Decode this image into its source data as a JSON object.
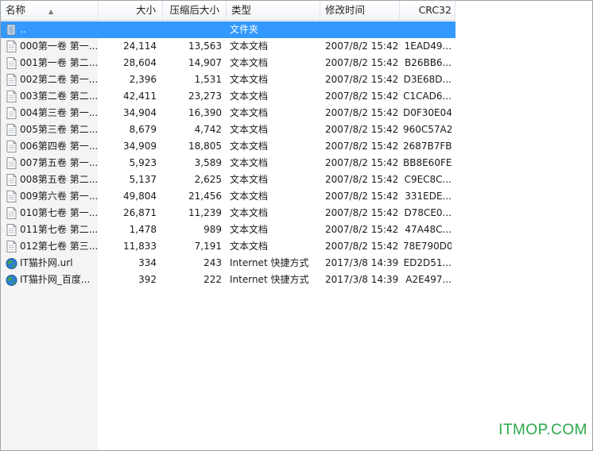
{
  "columns": {
    "name": "名称",
    "size": "大小",
    "packed": "压缩后大小",
    "type": "类型",
    "modified": "修改时间",
    "crc": "CRC32"
  },
  "parent_row": {
    "name": "..",
    "type": "文件夹"
  },
  "files": [
    {
      "name": "000第一卷 第一...",
      "size": "24,114",
      "packed": "13,563",
      "type": "文本文档",
      "modified": "2007/8/2 15:42",
      "crc": "1EAD49..."
    },
    {
      "name": "001第一卷 第二...",
      "size": "28,604",
      "packed": "14,907",
      "type": "文本文档",
      "modified": "2007/8/2 15:42",
      "crc": "B26BB6..."
    },
    {
      "name": "002第二卷 第一...",
      "size": "2,396",
      "packed": "1,531",
      "type": "文本文档",
      "modified": "2007/8/2 15:42",
      "crc": "D3E68D..."
    },
    {
      "name": "003第二卷 第二...",
      "size": "42,411",
      "packed": "23,273",
      "type": "文本文档",
      "modified": "2007/8/2 15:42",
      "crc": "C1CAD6..."
    },
    {
      "name": "004第三卷 第一...",
      "size": "34,904",
      "packed": "16,390",
      "type": "文本文档",
      "modified": "2007/8/2 15:42",
      "crc": "D0F30E04"
    },
    {
      "name": "005第三卷 第二...",
      "size": "8,679",
      "packed": "4,742",
      "type": "文本文档",
      "modified": "2007/8/2 15:42",
      "crc": "960C57A2"
    },
    {
      "name": "006第四卷 第一...",
      "size": "34,909",
      "packed": "18,805",
      "type": "文本文档",
      "modified": "2007/8/2 15:42",
      "crc": "2687B7FB"
    },
    {
      "name": "007第五卷 第一...",
      "size": "5,923",
      "packed": "3,589",
      "type": "文本文档",
      "modified": "2007/8/2 15:42",
      "crc": "BB8E60FE"
    },
    {
      "name": "008第五卷 第二...",
      "size": "5,137",
      "packed": "2,625",
      "type": "文本文档",
      "modified": "2007/8/2 15:42",
      "crc": "C9EC8C..."
    },
    {
      "name": "009第六卷 第一...",
      "size": "49,804",
      "packed": "21,456",
      "type": "文本文档",
      "modified": "2007/8/2 15:42",
      "crc": "331EDE..."
    },
    {
      "name": "010第七卷 第一...",
      "size": "26,871",
      "packed": "11,239",
      "type": "文本文档",
      "modified": "2007/8/2 15:42",
      "crc": "D78CE0..."
    },
    {
      "name": "011第七卷 第二...",
      "size": "1,478",
      "packed": "989",
      "type": "文本文档",
      "modified": "2007/8/2 15:42",
      "crc": "47A48C..."
    },
    {
      "name": "012第七卷 第三...",
      "size": "11,833",
      "packed": "7,191",
      "type": "文本文档",
      "modified": "2007/8/2 15:42",
      "crc": "78E790D0"
    },
    {
      "name": "IT猫扑网.url",
      "size": "334",
      "packed": "243",
      "type": "Internet 快捷方式",
      "modified": "2017/3/8 14:39",
      "crc": "ED2D51..."
    },
    {
      "name": "IT猫扑网_百度...",
      "size": "392",
      "packed": "222",
      "type": "Internet 快捷方式",
      "modified": "2017/3/8 14:39",
      "crc": "A2E497..."
    }
  ],
  "file_icons": [
    "text-file-icon",
    "text-file-icon",
    "text-file-icon",
    "text-file-icon",
    "text-file-icon",
    "text-file-icon",
    "text-file-icon",
    "text-file-icon",
    "text-file-icon",
    "text-file-icon",
    "text-file-icon",
    "text-file-icon",
    "text-file-icon",
    "internet-shortcut-icon",
    "internet-shortcut-icon"
  ],
  "selection_color": "#3399ff",
  "watermark": "ITMOP.COM"
}
